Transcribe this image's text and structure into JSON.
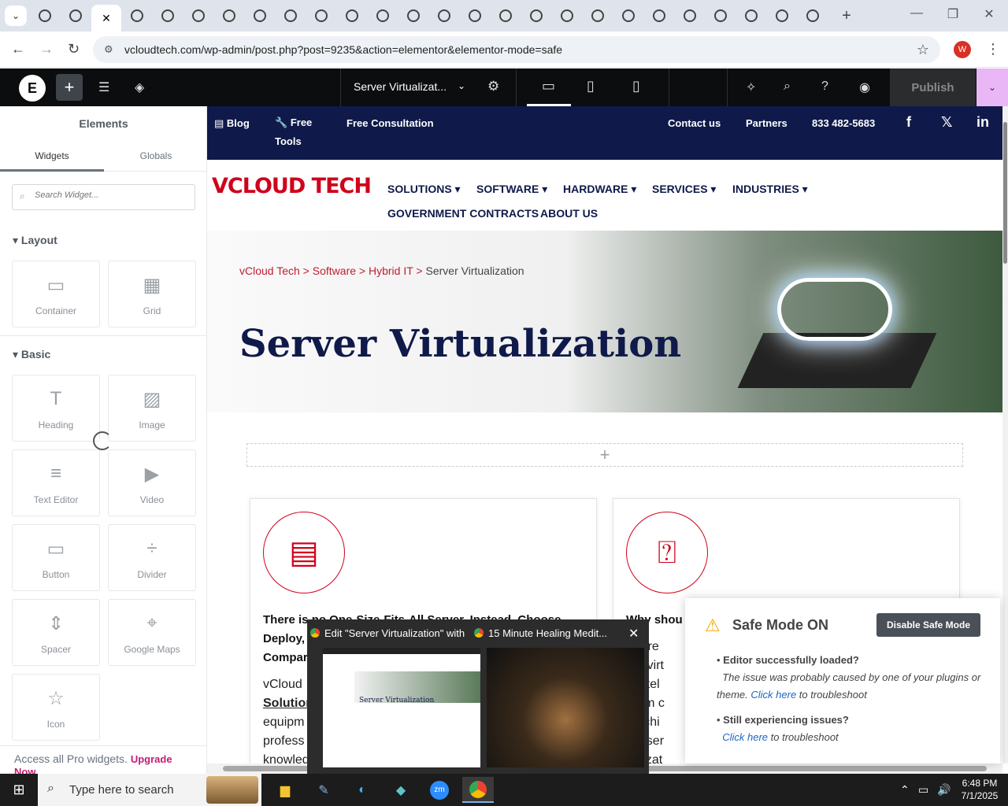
{
  "browser": {
    "url": "vcloudtech.com/wp-admin/post.php?post=9235&action=elementor&elementor-mode=safe",
    "tab_count_visible": 26,
    "profile_initial": "W"
  },
  "elementor": {
    "doc_title": "Server Virtualizat...",
    "publish_label": "Publish",
    "panel": {
      "title": "Elements",
      "tabs": [
        "Widgets",
        "Globals"
      ],
      "search_placeholder": "Search Widget...",
      "sections": [
        {
          "name": "Layout",
          "widgets": [
            {
              "label": "Container",
              "icon": "container-icon"
            },
            {
              "label": "Grid",
              "icon": "grid-icon"
            }
          ]
        },
        {
          "name": "Basic",
          "widgets": [
            {
              "label": "Heading",
              "icon": "heading-icon"
            },
            {
              "label": "Image",
              "icon": "image-icon"
            },
            {
              "label": "Text Editor",
              "icon": "text-editor-icon"
            },
            {
              "label": "Video",
              "icon": "video-icon"
            },
            {
              "label": "Button",
              "icon": "button-icon"
            },
            {
              "label": "Divider",
              "icon": "divider-icon"
            },
            {
              "label": "Spacer",
              "icon": "spacer-icon"
            },
            {
              "label": "Google Maps",
              "icon": "google-maps-icon"
            },
            {
              "label": "Icon",
              "icon": "star-icon"
            }
          ]
        }
      ],
      "upsell_text": "Access all Pro widgets.",
      "upsell_link": "Upgrade Now"
    }
  },
  "site": {
    "topbar": {
      "blog": "Blog",
      "free_tools": "Free\nTools",
      "free_consultation": "Free Consultation",
      "contact": "Contact us",
      "partners": "Partners",
      "phone": "833 482-5683"
    },
    "logo": {
      "part1": "VCLOUD",
      "part2": " TECH"
    },
    "nav": [
      {
        "label": "SOLUTIONS"
      },
      {
        "label": "SOFTWARE"
      },
      {
        "label": "HARDWARE"
      },
      {
        "label": "SERVICES"
      },
      {
        "label": "INDUSTRIES"
      },
      {
        "label": "GOVERNMENT CONTRACTS"
      },
      {
        "label": "ABOUT US"
      }
    ],
    "breadcrumbs": [
      "vCloud Tech",
      "Software",
      "Hybrid IT",
      "Server Virtualization"
    ],
    "breadcrumb_sep": ">",
    "hero_title": "Server Virtualization",
    "cards": [
      {
        "heading": "There is no One-Size-Fits-All Server. Instead, Choose, Deploy,",
        "heading_tail": "Compar",
        "body_lines": [
          "vCloud",
          "Solution",
          "equipm",
          "profess",
          "knowled"
        ]
      },
      {
        "heading": "Why shou",
        "body_lines": [
          "re are",
          "ver virt",
          "e intel",
          "gram c",
          "machi",
          "ual ser",
          "ualizat"
        ]
      }
    ]
  },
  "safe_mode": {
    "title": "Safe Mode ON",
    "button": "Disable Safe Mode",
    "item1_title": "Editor successfully loaded?",
    "item1_text_a": "The issue was probably caused by one of your plugins or theme.",
    "item1_link": "Click here",
    "item1_text_b": "to troubleshoot",
    "item2_title": "Still experiencing issues?",
    "item2_link": "Click here",
    "item2_text_b": "to troubleshoot"
  },
  "taskbar_previews": [
    {
      "title": "Edit \"Server Virtualization\" with ..."
    },
    {
      "title": "15 Minute Healing Medit..."
    }
  ],
  "preview_thumb_title": "Server Virtualization",
  "windows": {
    "search_placeholder": "Type here to search",
    "time": "6:48 PM",
    "date": "7/1/2025"
  }
}
